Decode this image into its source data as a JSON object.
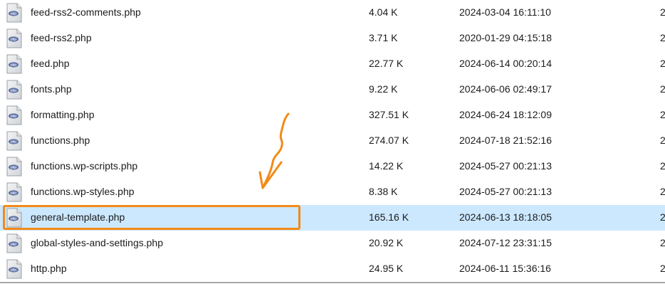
{
  "files": [
    {
      "name": "feed-rss2-comments.php",
      "size": "4.04 K",
      "date": "2024-03-04 16:11:10",
      "extra": "2"
    },
    {
      "name": "feed-rss2.php",
      "size": "3.71 K",
      "date": "2020-01-29 04:15:18",
      "extra": "2"
    },
    {
      "name": "feed.php",
      "size": "22.77 K",
      "date": "2024-06-14 00:20:14",
      "extra": "2"
    },
    {
      "name": "fonts.php",
      "size": "9.22 K",
      "date": "2024-06-06 02:49:17",
      "extra": "2"
    },
    {
      "name": "formatting.php",
      "size": "327.51 K",
      "date": "2024-06-24 18:12:09",
      "extra": "2"
    },
    {
      "name": "functions.php",
      "size": "274.07 K",
      "date": "2024-07-18 21:52:16",
      "extra": "2"
    },
    {
      "name": "functions.wp-scripts.php",
      "size": "14.22 K",
      "date": "2024-05-27 00:21:13",
      "extra": "2"
    },
    {
      "name": "functions.wp-styles.php",
      "size": "8.38 K",
      "date": "2024-05-27 00:21:13",
      "extra": "2"
    },
    {
      "name": "general-template.php",
      "size": "165.16 K",
      "date": "2024-06-13 18:18:05",
      "extra": "2",
      "selected": true
    },
    {
      "name": "global-styles-and-settings.php",
      "size": "20.92 K",
      "date": "2024-07-12 23:31:15",
      "extra": "2"
    },
    {
      "name": "http.php",
      "size": "24.95 K",
      "date": "2024-06-11 15:36:16",
      "extra": "2"
    }
  ],
  "colors": {
    "selected_bg": "#cce8ff",
    "annotation": "#f28a17"
  },
  "icons": {
    "file": "php-file-icon"
  }
}
